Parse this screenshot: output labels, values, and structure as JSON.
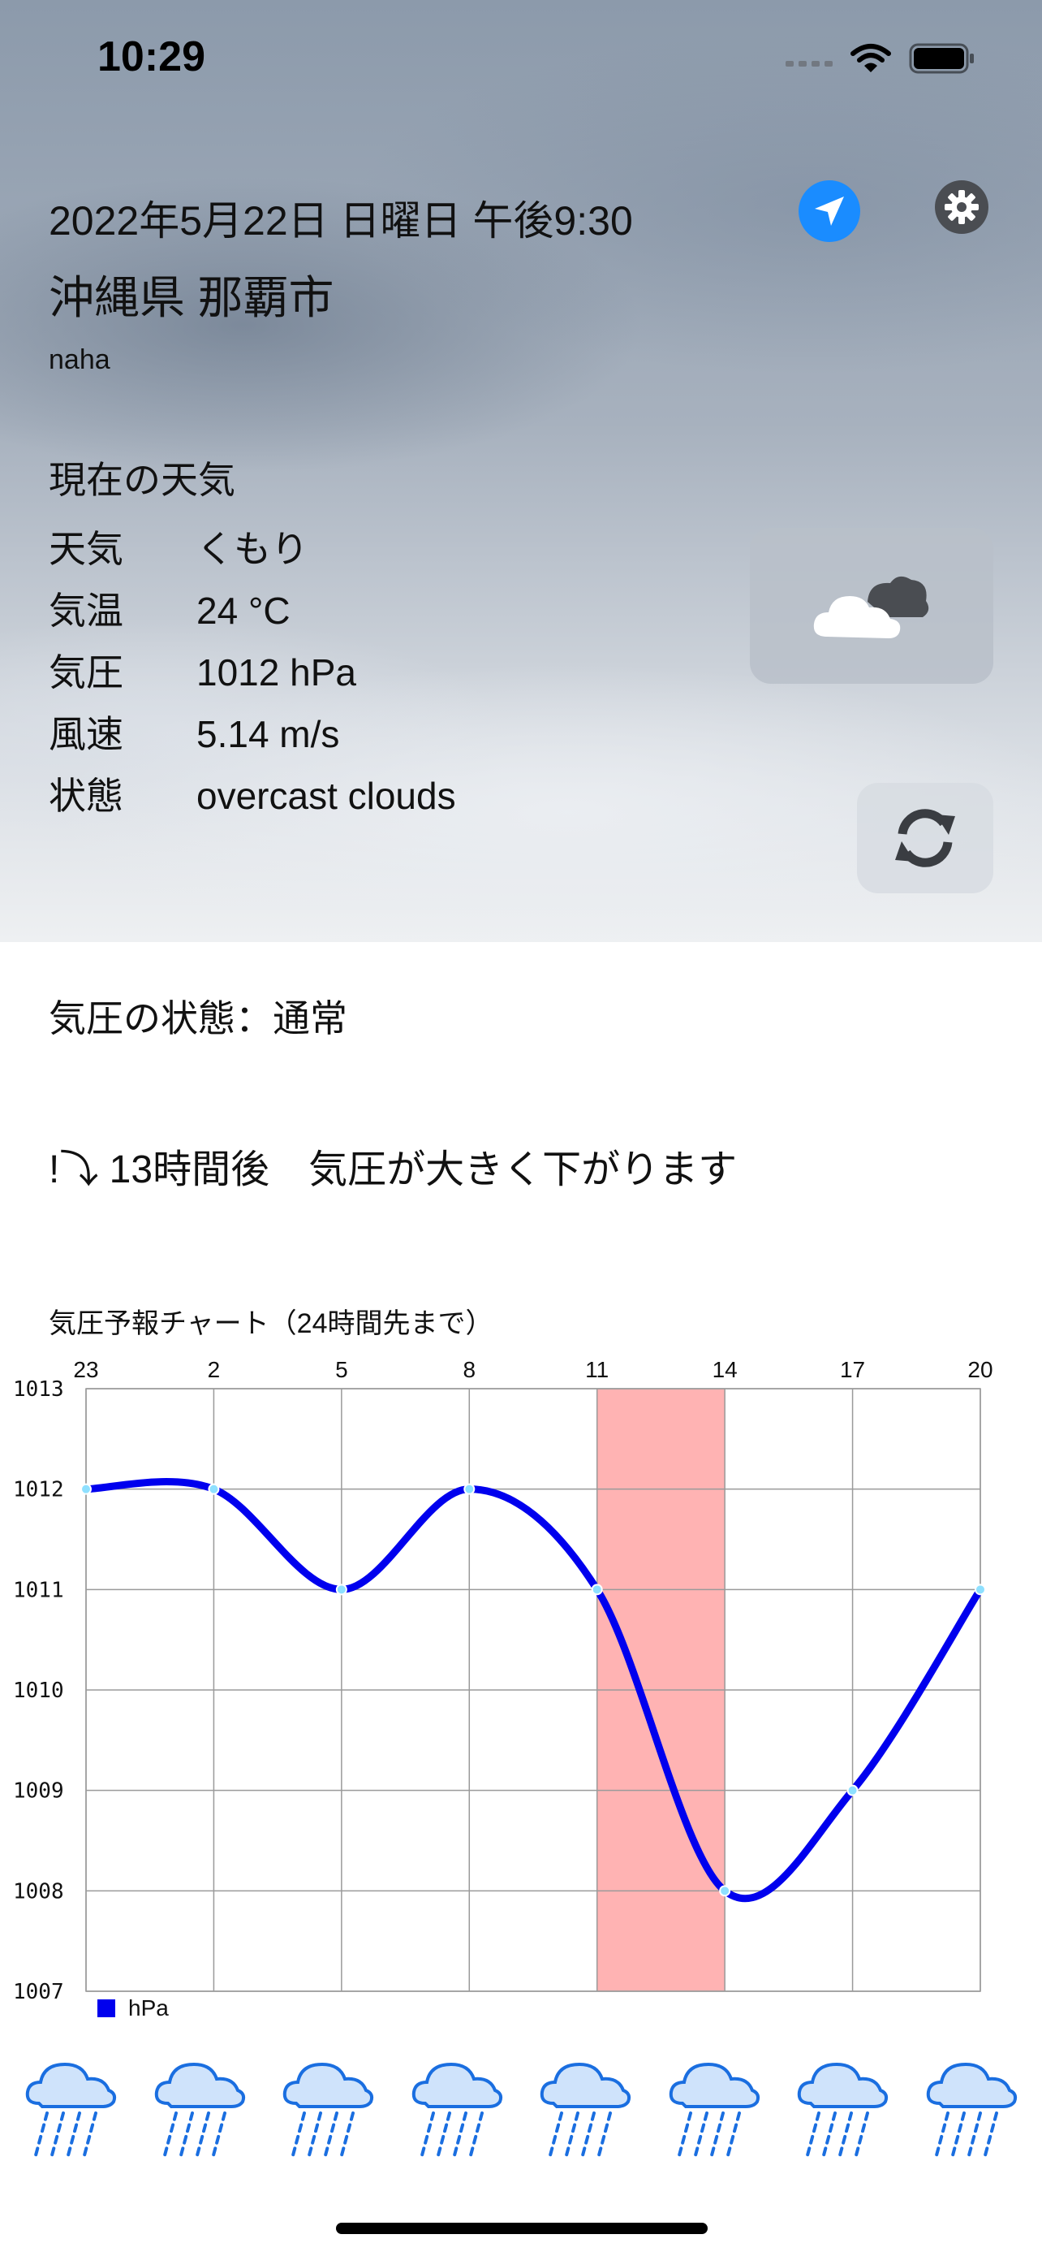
{
  "status_bar": {
    "time": "10:29"
  },
  "header": {
    "datetime": "2022年5月22日 日曜日 午後9:30",
    "city": "沖縄県 那覇市",
    "city_romaji": "naha",
    "location_icon": "location-arrow-icon",
    "settings_icon": "gear-icon"
  },
  "current": {
    "title": "現在の天気",
    "rows": [
      {
        "label": "天気",
        "value": "くもり"
      },
      {
        "label": "気温",
        "value": "24 °C"
      },
      {
        "label": "気圧",
        "value": "1012 hPa"
      },
      {
        "label": "風速",
        "value": "5.14 m/s"
      },
      {
        "label": "状態",
        "value": "overcast clouds"
      }
    ],
    "weather_icon": "cloud-icon",
    "refresh_icon": "refresh-icon"
  },
  "pressure_state": "気圧の状態：通常",
  "forecast_message": "!⤵ 13時間後　気圧が大きく下がります",
  "chart_title": "気圧予報チャート（24時間先まで）",
  "chart_data": {
    "type": "line",
    "x": [
      "23",
      "2",
      "5",
      "8",
      "11",
      "14",
      "17",
      "20"
    ],
    "series": [
      {
        "name": "hPa",
        "values": [
          1012,
          1012,
          1011,
          1012,
          1011,
          1008,
          1009,
          1011
        ],
        "color": "#0000ee"
      }
    ],
    "ylim": [
      1007,
      1013
    ],
    "yticks": [
      "1013",
      "1012",
      "1011",
      "1010",
      "1009",
      "1008",
      "1007"
    ],
    "highlight": {
      "from": "11",
      "to": "14",
      "color": "#ffb3b3"
    },
    "grid": true,
    "legend": "bottom-left"
  },
  "forecast_icons": [
    "rain-icon",
    "rain-icon",
    "rain-icon",
    "rain-icon",
    "rain-icon",
    "rain-icon",
    "rain-icon",
    "rain-icon"
  ]
}
